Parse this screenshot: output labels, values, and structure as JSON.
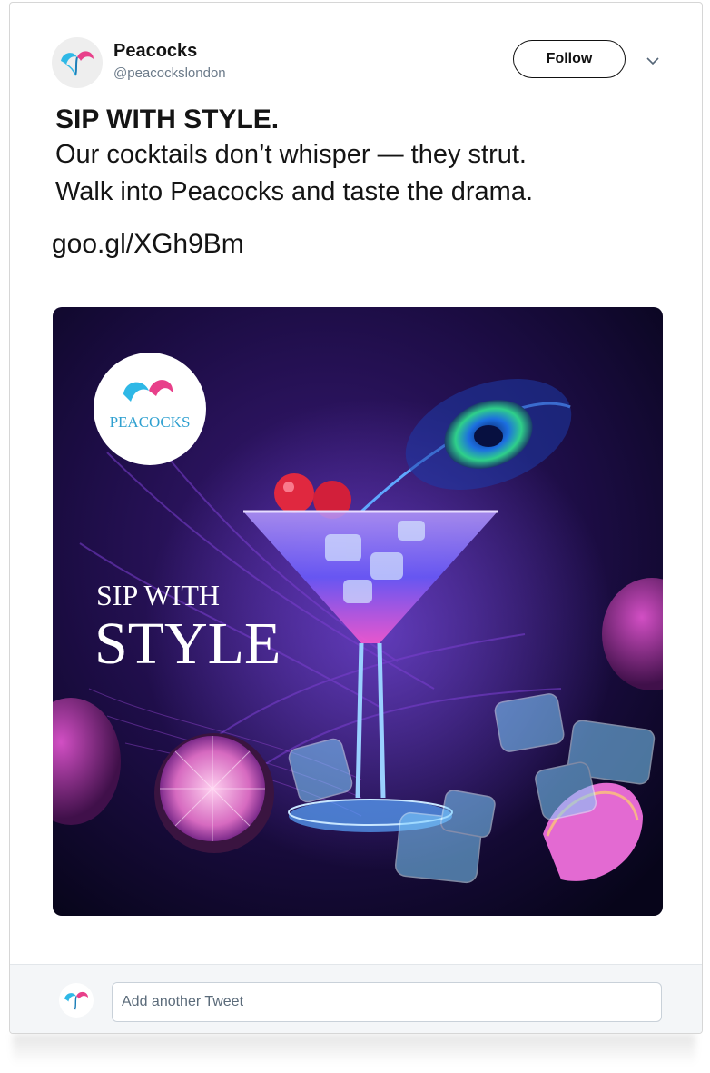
{
  "account": {
    "name": "Peacocks",
    "handle": "@peacockslondon",
    "follow_label": "Follow"
  },
  "tweet": {
    "headline": "SIP WITH STYLE.",
    "line1": "Our cocktails don’t whisper — they strut.",
    "line2": "Walk into Peacocks and taste the drama.",
    "link": "goo.gl/XGh9Bm"
  },
  "media": {
    "logo_text": "PEACOCKS",
    "overlay_line1": "SIP WITH",
    "overlay_line2": "STYLE"
  },
  "reply": {
    "placeholder": "Add another Tweet"
  },
  "icons": {
    "chevron": "chevron-down-icon",
    "logo": "peacock-feather-logo-icon"
  },
  "colors": {
    "logo_blue": "#2fb8e6",
    "logo_pink": "#e8408a",
    "image_bg": "#1a0a3a"
  }
}
